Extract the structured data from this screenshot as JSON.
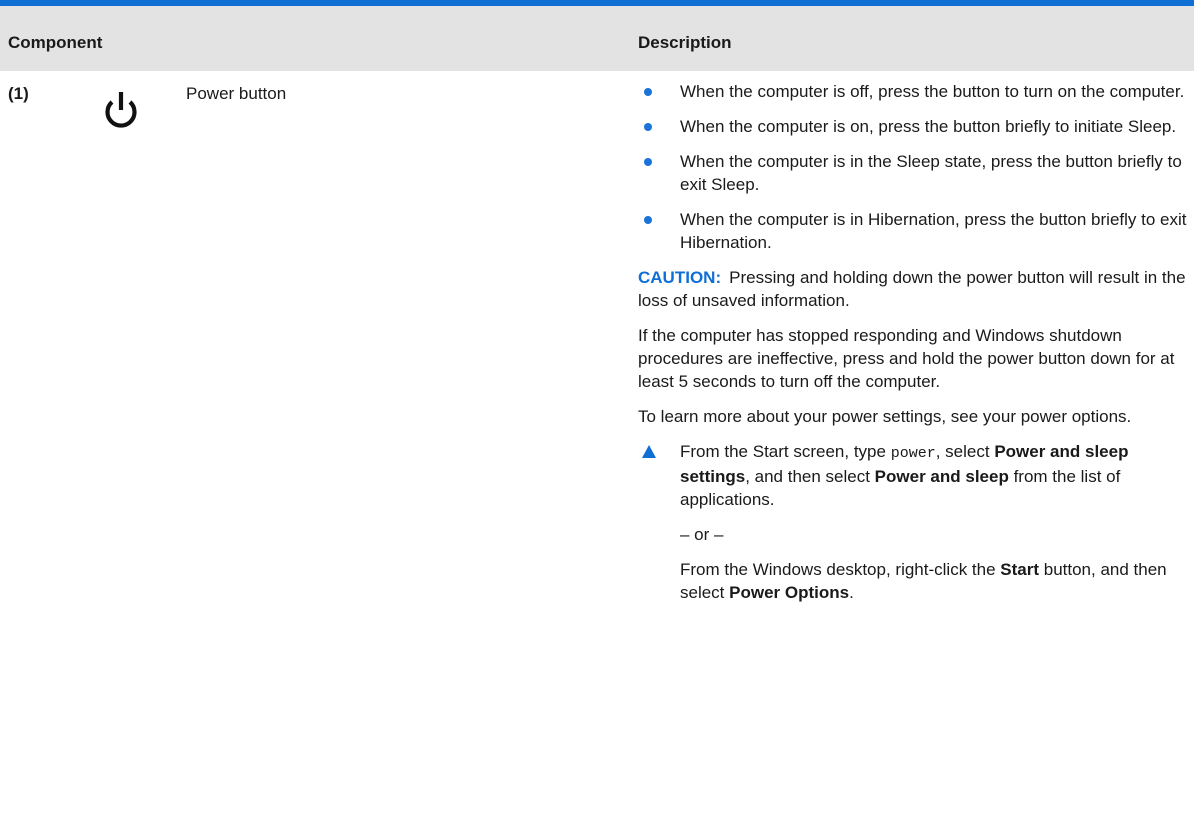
{
  "colors": {
    "accent": "#0f6fd4",
    "header_bg": "#e3e3e3",
    "bullet": "#1a73d9"
  },
  "table": {
    "headers": {
      "component": "Component",
      "description": "Description"
    },
    "row": {
      "index": "(1)",
      "icon": "power-icon",
      "name": "Power button"
    }
  },
  "description": {
    "bullets": [
      "When the computer is off, press the button to turn on the computer.",
      "When the computer is on, press the button briefly to initiate Sleep.",
      "When the computer is in the Sleep state, press the button briefly to exit Sleep.",
      "When the computer is in Hibernation, press the button briefly to exit Hibernation."
    ],
    "caution": {
      "label": "CAUTION:",
      "text": "Pressing and holding down the power button will result in the loss of unsaved information."
    },
    "para_unresponsive": "If the computer has stopped responding and Windows shutdown procedures are ineffective, press and hold the power button down for at least 5 seconds to turn off the computer.",
    "para_learn_more": "To learn more about your power settings, see your power options.",
    "step": {
      "t1": "From the Start screen, type ",
      "code": "power",
      "t2": ", select ",
      "b1": "Power and sleep settings",
      "t3": ", and then select ",
      "b2": "Power and sleep",
      "t4": " from the list of applications."
    },
    "or_text": "– or –",
    "alt": {
      "t1": "From the Windows desktop, right-click the ",
      "b1": "Start",
      "t2": " button, and then select ",
      "b2": "Power Options",
      "t3": "."
    }
  }
}
